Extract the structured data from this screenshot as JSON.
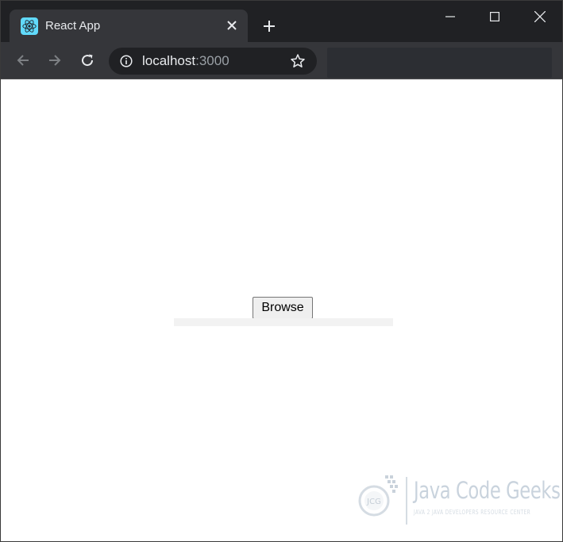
{
  "browser": {
    "tab_title": "React App",
    "url_host": "localhost",
    "url_port": ":3000"
  },
  "page": {
    "browse_button_label": "Browse"
  },
  "watermark": {
    "logo_text": "Java Code Geeks",
    "tagline": "JAVA 2 JAVA DEVELOPERS RESOURCE CENTER",
    "badge": "JCG"
  },
  "colors": {
    "titlebar": "#202124",
    "tab_active": "#35363a",
    "toolbar": "#35363a",
    "omnibox": "#202124",
    "react_blue": "#61dafb"
  },
  "icons": [
    "react-favicon-icon",
    "close-icon",
    "plus-icon",
    "minimize-icon",
    "maximize-icon",
    "window-close-icon",
    "back-arrow-icon",
    "forward-arrow-icon",
    "reload-icon",
    "info-icon",
    "star-icon"
  ]
}
